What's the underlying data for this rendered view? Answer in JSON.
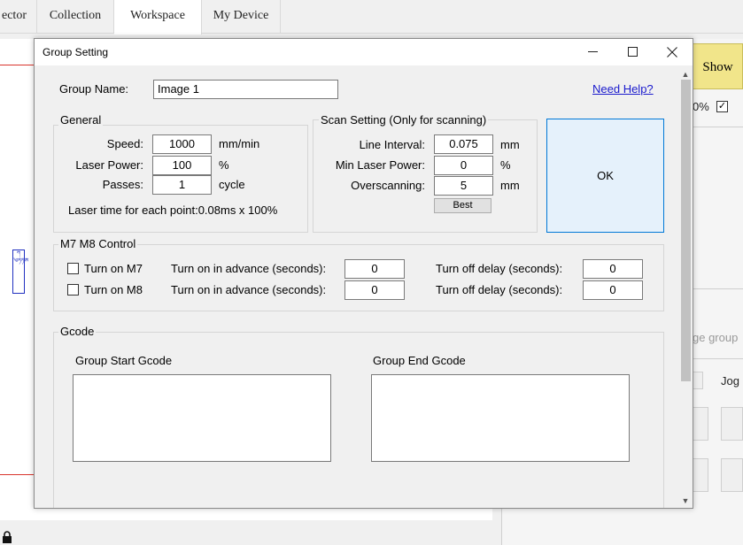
{
  "app": {
    "tabs": [
      {
        "label": "ector"
      },
      {
        "label": "Collection"
      },
      {
        "label": "Workspace"
      },
      {
        "label": "My Device"
      }
    ],
    "canvas_object_text": "ཀ༄ཏཏཨ",
    "right_panel": {
      "show_label": "Show",
      "pct_text": "0%",
      "checkbox_mark": "✓",
      "faded_text": "ge group",
      "jog_label": "Jog"
    }
  },
  "dialog": {
    "title": "Group Setting",
    "window_controls": {
      "minimize": "—",
      "maximize": "☐",
      "close": "✕"
    },
    "group_name_label": "Group Name:",
    "group_name_value": "Image 1",
    "help_link": "Need Help?",
    "ok_label": "OK",
    "general": {
      "legend": "General",
      "speed_label": "Speed:",
      "speed_value": "1000",
      "speed_unit": "mm/min",
      "laser_power_label": "Laser Power:",
      "laser_power_value": "100",
      "laser_power_unit": "%",
      "passes_label": "Passes:",
      "passes_value": "1",
      "passes_unit": "cycle",
      "laser_time_text": "Laser time for each point:0.08ms x 100%"
    },
    "scan": {
      "legend": "Scan Setting (Only for scanning)",
      "line_interval_label": "Line Interval:",
      "line_interval_value": "0.075",
      "line_interval_unit": "mm",
      "min_power_label": "Min Laser Power:",
      "min_power_value": "0",
      "min_power_unit": "%",
      "overscanning_label": "Overscanning:",
      "overscanning_value": "5",
      "overscanning_unit": "mm",
      "best_label": "Best"
    },
    "m7m8": {
      "legend": "M7 M8 Control",
      "rows": [
        {
          "checkbox_label": "Turn on M7",
          "advance_label": "Turn on in advance (seconds):",
          "advance_value": "0",
          "delay_label": "Turn off delay (seconds):",
          "delay_value": "0"
        },
        {
          "checkbox_label": "Turn on M8",
          "advance_label": "Turn on in advance (seconds):",
          "advance_value": "0",
          "delay_label": "Turn off delay (seconds):",
          "delay_value": "0"
        }
      ]
    },
    "gcode": {
      "legend": "Gcode",
      "start_label": "Group Start Gcode",
      "end_label": "Group End Gcode"
    },
    "scrollbar": {
      "up_arrow": "▲",
      "down_arrow": "▼"
    }
  }
}
